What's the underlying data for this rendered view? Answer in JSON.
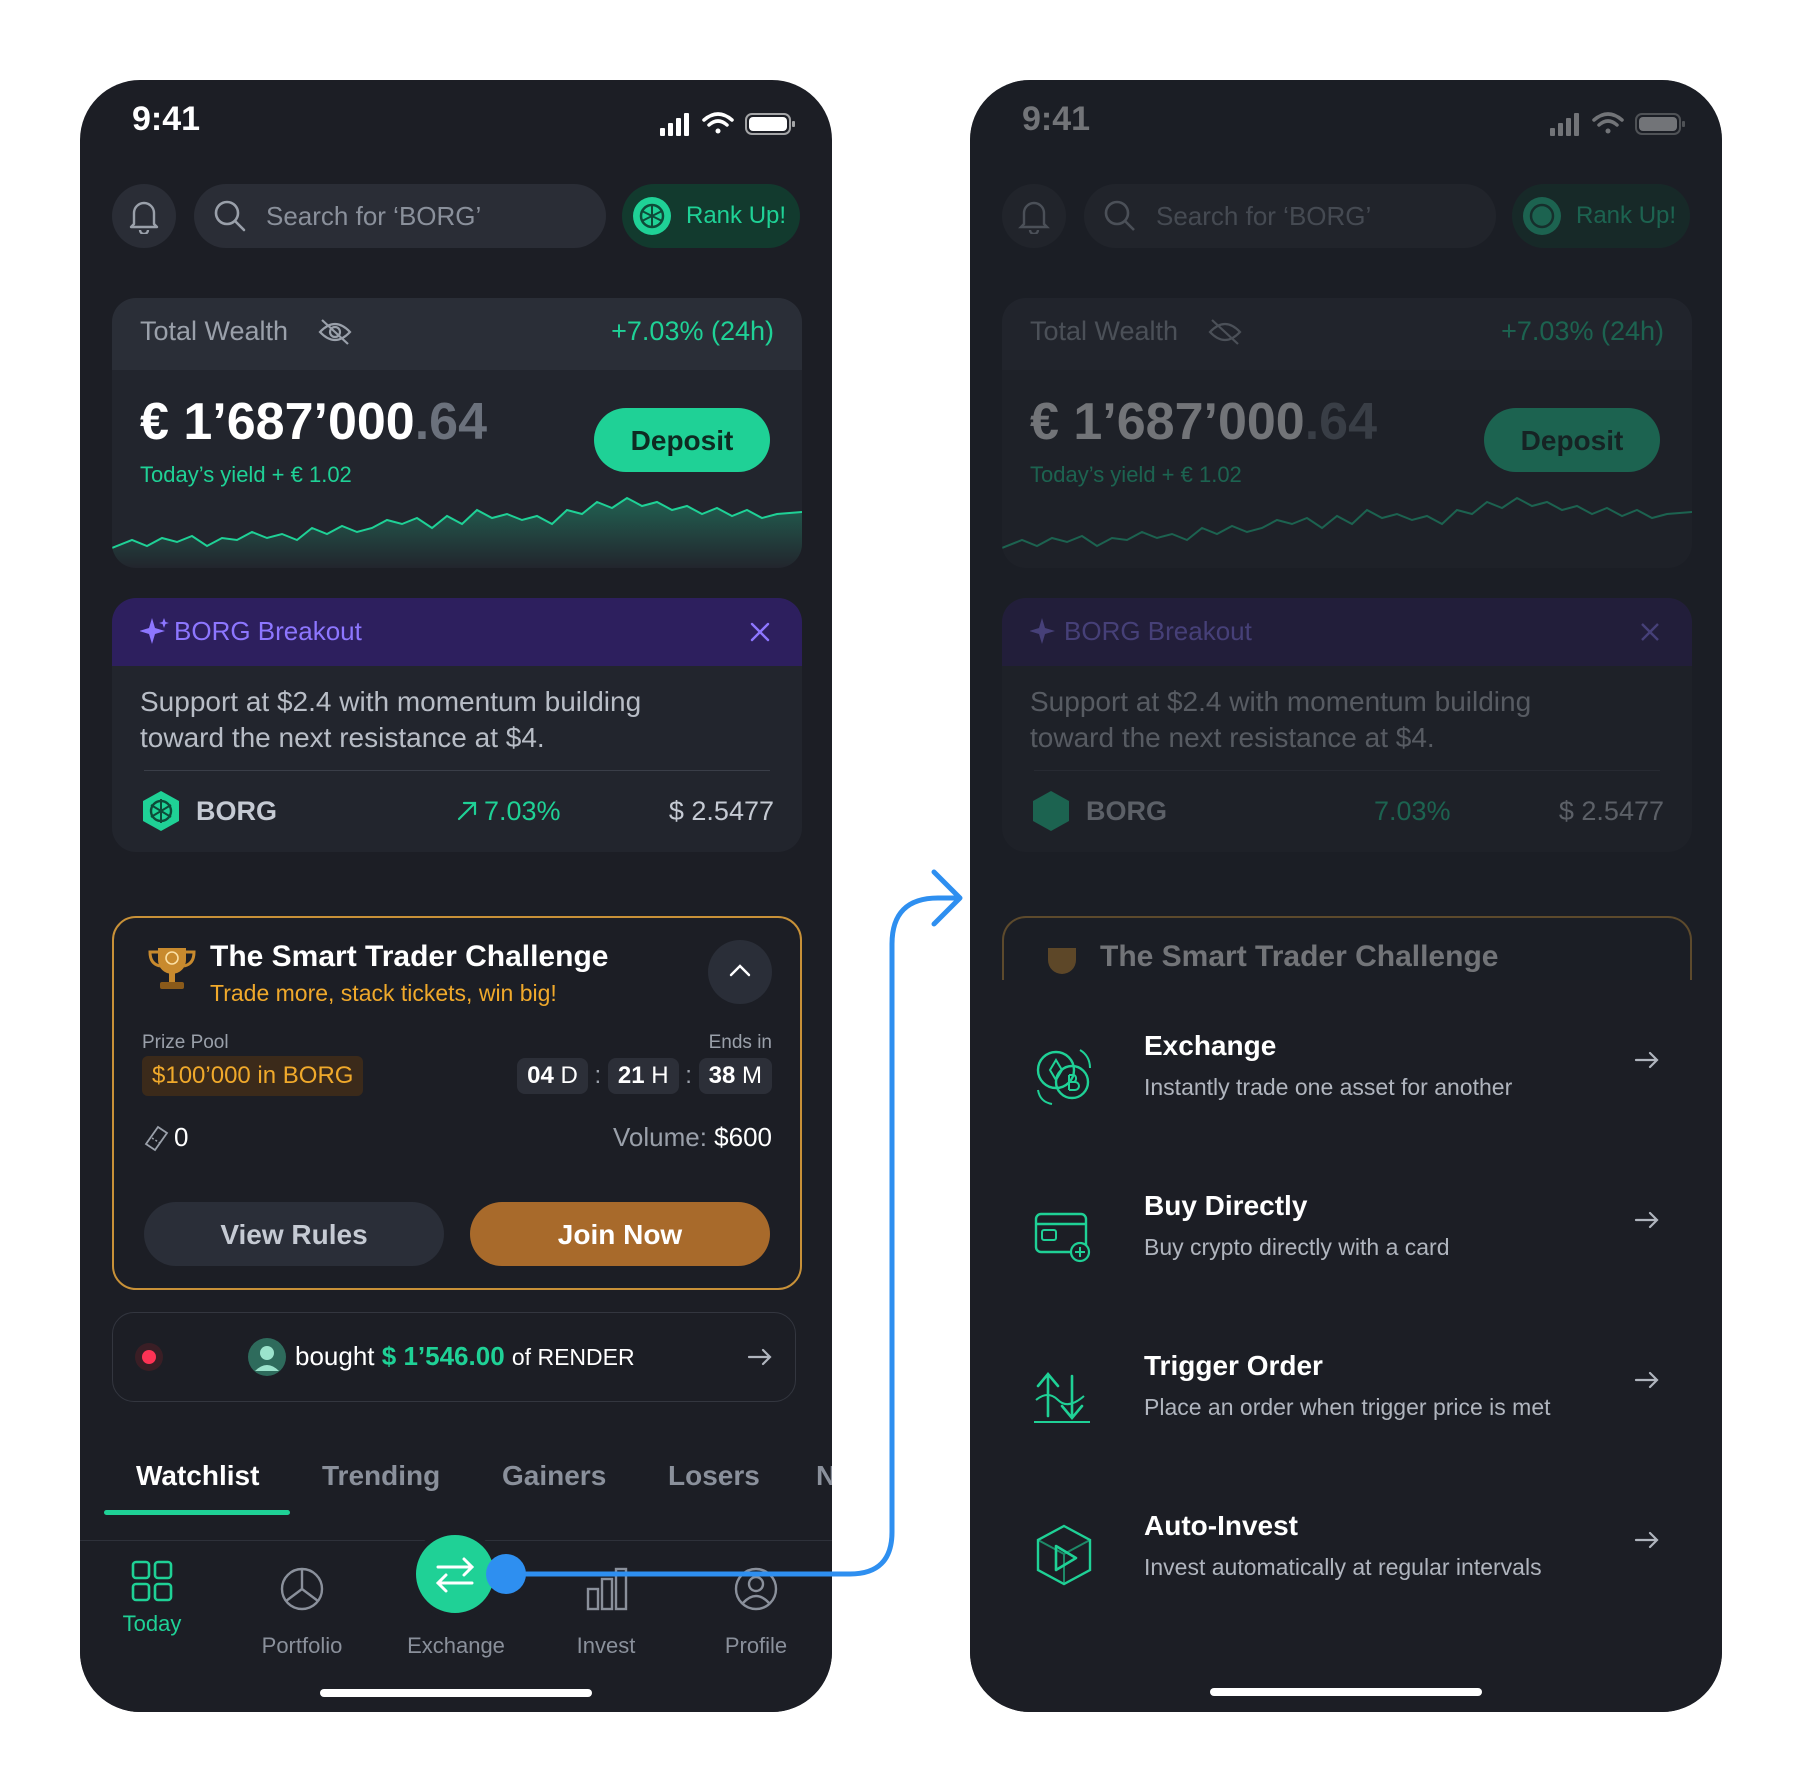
{
  "status": {
    "time": "9:41"
  },
  "search": {
    "placeholder": "Search for ‘BORG’"
  },
  "rank": {
    "label": "Rank Up!"
  },
  "wealth": {
    "label": "Total Wealth",
    "change": "+7.03% (24h)",
    "amount_main": "€ 1’687’000",
    "amount_cents": ".64",
    "yield": "Today’s yield + € 1.02",
    "deposit_label": "Deposit"
  },
  "breakout": {
    "title": "BORG Breakout",
    "body": "Support at $2.4 with momentum building toward the next resistance at $4.",
    "coin": "BORG",
    "change": "7.03%",
    "price": "$ 2.5477"
  },
  "challenge": {
    "title": "The Smart Trader Challenge",
    "subtitle": "Trade more, stack tickets, win big!",
    "prize_label": "Prize Pool",
    "prize_value": "$100’000 in BORG",
    "ends_label": "Ends in",
    "days": "04",
    "days_unit": "D",
    "hours": "21",
    "hours_unit": "H",
    "minutes": "38",
    "minutes_unit": "M",
    "sep": ":",
    "tickets": "0",
    "volume_label": "Volume:",
    "volume_value": "$600",
    "rules_label": "View Rules",
    "join_label": "Join Now"
  },
  "ticker": {
    "verb": "bought",
    "amount": "$ 1’546.00",
    "suffix": "of RENDER"
  },
  "tabs": [
    {
      "label": "Watchlist"
    },
    {
      "label": "Trending"
    },
    {
      "label": "Gainers"
    },
    {
      "label": "Losers"
    },
    {
      "label": "N"
    }
  ],
  "nav": [
    {
      "label": "Today"
    },
    {
      "label": "Portfolio"
    },
    {
      "label": "Exchange"
    },
    {
      "label": "Invest"
    },
    {
      "label": "Profile"
    }
  ],
  "actions": [
    {
      "title": "Exchange",
      "subtitle": "Instantly trade one asset for another",
      "icon": "exchange-coins-icon"
    },
    {
      "title": "Buy Directly",
      "subtitle": "Buy crypto directly with a card",
      "icon": "card-wallet-icon"
    },
    {
      "title": "Trigger Order",
      "subtitle": "Place an order when trigger price is met",
      "icon": "trigger-arrows-icon"
    },
    {
      "title": "Auto-Invest",
      "subtitle": "Invest automatically at regular intervals",
      "icon": "auto-invest-cube-icon"
    }
  ],
  "colors": {
    "accent": "#1fd196",
    "gold": "#f0a92b",
    "purple": "#8d76ff",
    "background": "#1c1e25",
    "flow": "#2e8ff0"
  }
}
